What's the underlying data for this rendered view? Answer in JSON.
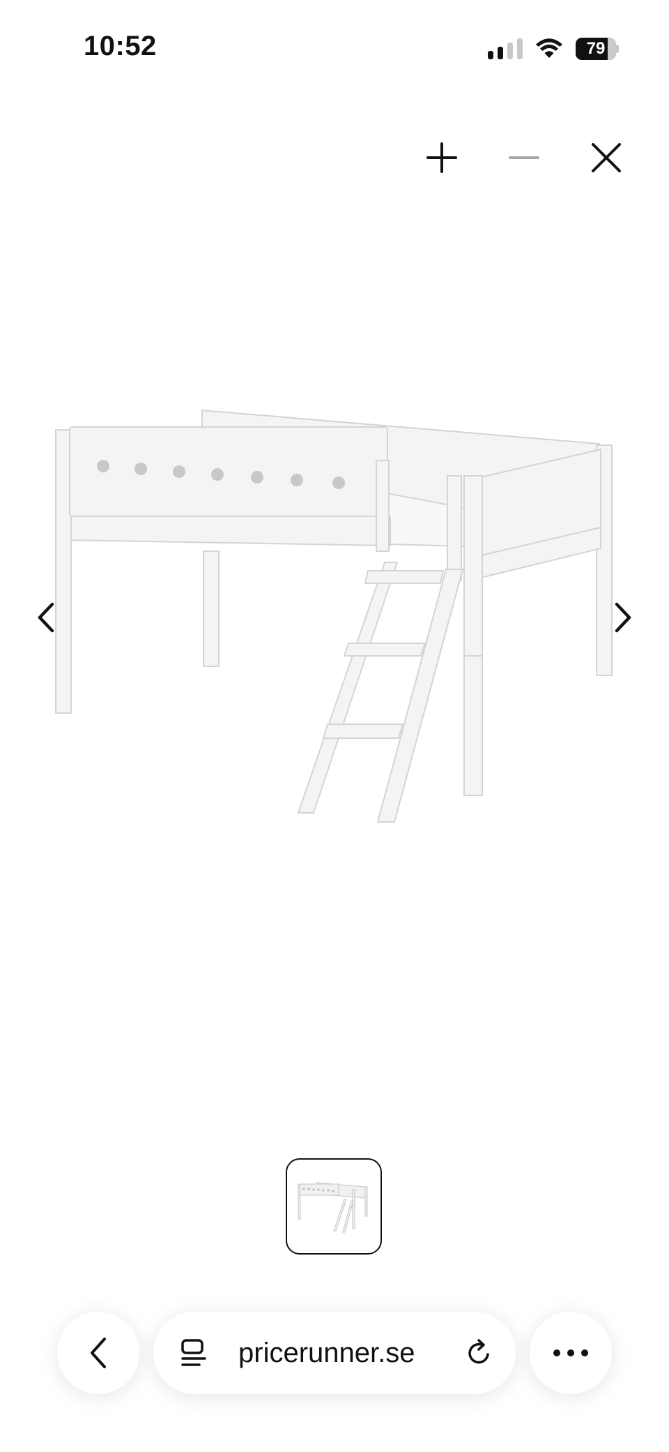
{
  "status_bar": {
    "time": "10:52",
    "battery_level": "79",
    "signal_bars_active": 2,
    "signal_bars_total": 4
  },
  "viewer": {
    "zoom_in_icon": "plus-icon",
    "zoom_out_icon": "minus-icon",
    "close_icon": "close-icon",
    "prev_icon": "chevron-left-icon",
    "next_icon": "chevron-right-icon"
  },
  "browser": {
    "url": "pricerunner.se",
    "back_icon": "chevron-left-icon",
    "tabs_icon": "tabs-icon",
    "reload_icon": "reload-icon",
    "more_icon": "ellipsis-icon"
  },
  "colors": {
    "accent": "#111111",
    "disabled": "#a7a7ad"
  }
}
